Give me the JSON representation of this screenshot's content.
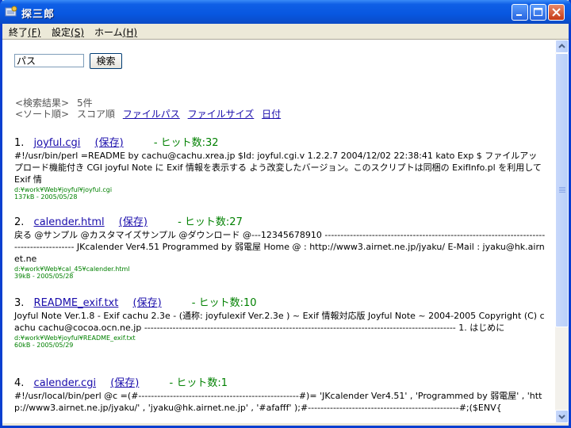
{
  "window": {
    "title": "探三郎"
  },
  "menu": [
    {
      "label": "終了",
      "accel": "(F)"
    },
    {
      "label": "設定",
      "accel": "(S)"
    },
    {
      "label": "ホーム",
      "accel": "(H)"
    }
  ],
  "search": {
    "value": "パス",
    "button_label": "検索"
  },
  "summary": {
    "label": "<検索結果>",
    "count": "5件"
  },
  "sort": {
    "label": "<ソート順>",
    "current": "スコア順",
    "options": [
      "ファイルパス",
      "ファイルサイズ",
      "日付"
    ]
  },
  "results": [
    {
      "num": "1.",
      "title": "joyful.cgi",
      "cache": "(保存)",
      "hits": "- ヒット数:32",
      "snippet": "#!/usr/bin/perl =README by cachu@cachu.xrea.jp $Id: joyful.cgi.v 1.2.2.7 2004/12/02 22:38:41 kato Exp $ ファイルアップロード機能付き CGI joyful Note に Exif 情報を表示する よう改変したバージョン。このスクリプトは同梱の ExifInfo.pl を利用して Exif 情",
      "path": "d:¥work¥Web¥joyful¥joyful.cgi",
      "meta": "137kB - 2005/05/28"
    },
    {
      "num": "2.",
      "title": "calender.html",
      "cache": "(保存)",
      "hits": "- ヒット数:27",
      "snippet": "戻る @サンプル @カスタマイズサンプル @ダウンロード @---12345678910 ----------------------------------------------------------------------------------------- JKcalender Ver4.51 Programmed by 弱電屋 Home @ : http://www3.airnet.ne.jp/jyaku/ E-Mail : jyaku@hk.airnet.ne",
      "path": "d:¥work¥Web¥cal_45¥calender.html",
      "meta": "39kB - 2005/05/28"
    },
    {
      "num": "3.",
      "title": "README_exif.txt",
      "cache": "(保存)",
      "hits": "- ヒット数:10",
      "snippet": "Joyful Note Ver.1.8 - Exif cachu 2.3e - (通称: joyfulexif Ver.2.3e ) ~ Exif 情報対応版 Joyful Note ~ 2004-2005 Copyright (C) cachu cachu@cocoa.ocn.ne.jp --------------------------------------------------------------------------------------------------- 1. はじめに",
      "path": "d:¥work¥Web¥joyful¥README_exif.txt",
      "meta": "60kB - 2005/05/29"
    },
    {
      "num": "4.",
      "title": "calender.cgi",
      "cache": "(保存)",
      "hits": "- ヒット数:1",
      "snippet": "#!/usr/local/bin/perl @c =(#---------------------------------------------------#)= 'JKcalender Ver4.51' , 'Programmed by 弱電屋' , 'http://www3.airnet.ne.jp/jyaku/' , 'jyaku@hk.airnet.ne.jp' , '#afafff' );#------------------------------------------------#;($ENV{",
      "path": "",
      "meta": ""
    }
  ],
  "colors": {
    "link": "#1a0dab",
    "hits": "#008000",
    "titlebar": "#0857e0"
  }
}
